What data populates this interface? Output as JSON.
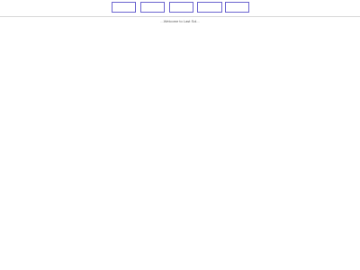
{
  "header": {
    "nav_buttons": [
      {
        "label": ""
      },
      {
        "label": ""
      },
      {
        "label": ""
      },
      {
        "label": ""
      },
      {
        "label": ""
      }
    ],
    "accent_color": "#6a63cf"
  },
  "main": {
    "welcome_text": "...Welcome to Last Sol..."
  }
}
